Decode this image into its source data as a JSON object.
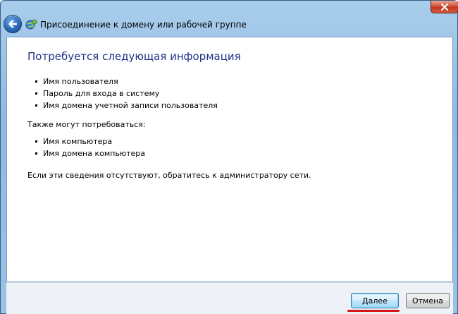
{
  "window": {
    "title": "Присоединение к домену или рабочей группе",
    "icons": {
      "back": "back-arrow-icon",
      "app": "network-join-icon",
      "close": "close-icon"
    }
  },
  "main": {
    "heading": "Потребуется следующая информация",
    "required_items": [
      "Имя пользователя",
      "Пароль для входа в систему",
      "Имя домена учетной записи пользователя"
    ],
    "also_label": "Также могут потребоваться:",
    "optional_items": [
      "Имя компьютера",
      "Имя домена компьютера"
    ],
    "contact_note": "Если эти сведения отсутствуют, обратитесь к администратору сети."
  },
  "footer": {
    "next_label": "Далее",
    "cancel_label": "Отмена"
  },
  "colors": {
    "heading": "#1e3287",
    "underline_highlight": "#d7141a",
    "close_button": "#c2381f"
  }
}
